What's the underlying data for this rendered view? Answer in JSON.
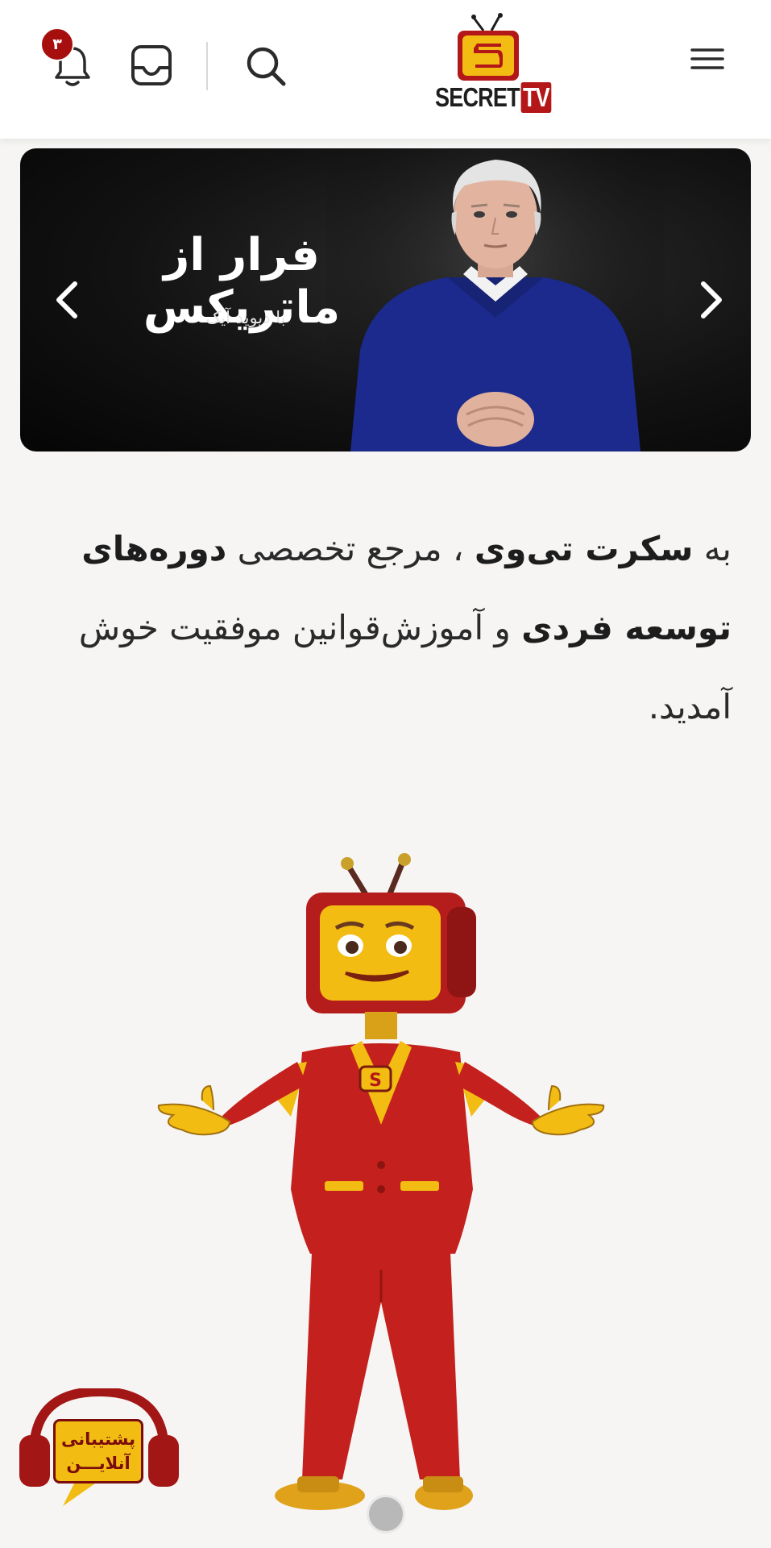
{
  "header": {
    "notification_count": "۳",
    "logo_text": "SECRET",
    "logo_tv": "TV",
    "icons": [
      "bell-icon",
      "inbox-icon",
      "search-icon",
      "hamburger-menu-icon"
    ]
  },
  "banner": {
    "title": "فرار از ماتریکس",
    "subtitle": "با دیوید آیک",
    "icons": [
      "chevron-left-icon",
      "chevron-right-icon"
    ]
  },
  "welcome": {
    "w1": "به ",
    "w2": "سکرت تی‌وی",
    "w3": " ، مرجع تخصصی ",
    "w4": "دوره‌های توسعه فردی",
    "w5": " و آموزش‌قوانین موفقیت خوش آمدید."
  },
  "support": {
    "line1": "پشتیبانی",
    "line2": "آنلایـــن"
  },
  "colors": {
    "brand_red": "#b31717",
    "brand_yellow": "#f2bc12",
    "badge_red": "#a70e0e",
    "background": "#f6f5f4"
  }
}
